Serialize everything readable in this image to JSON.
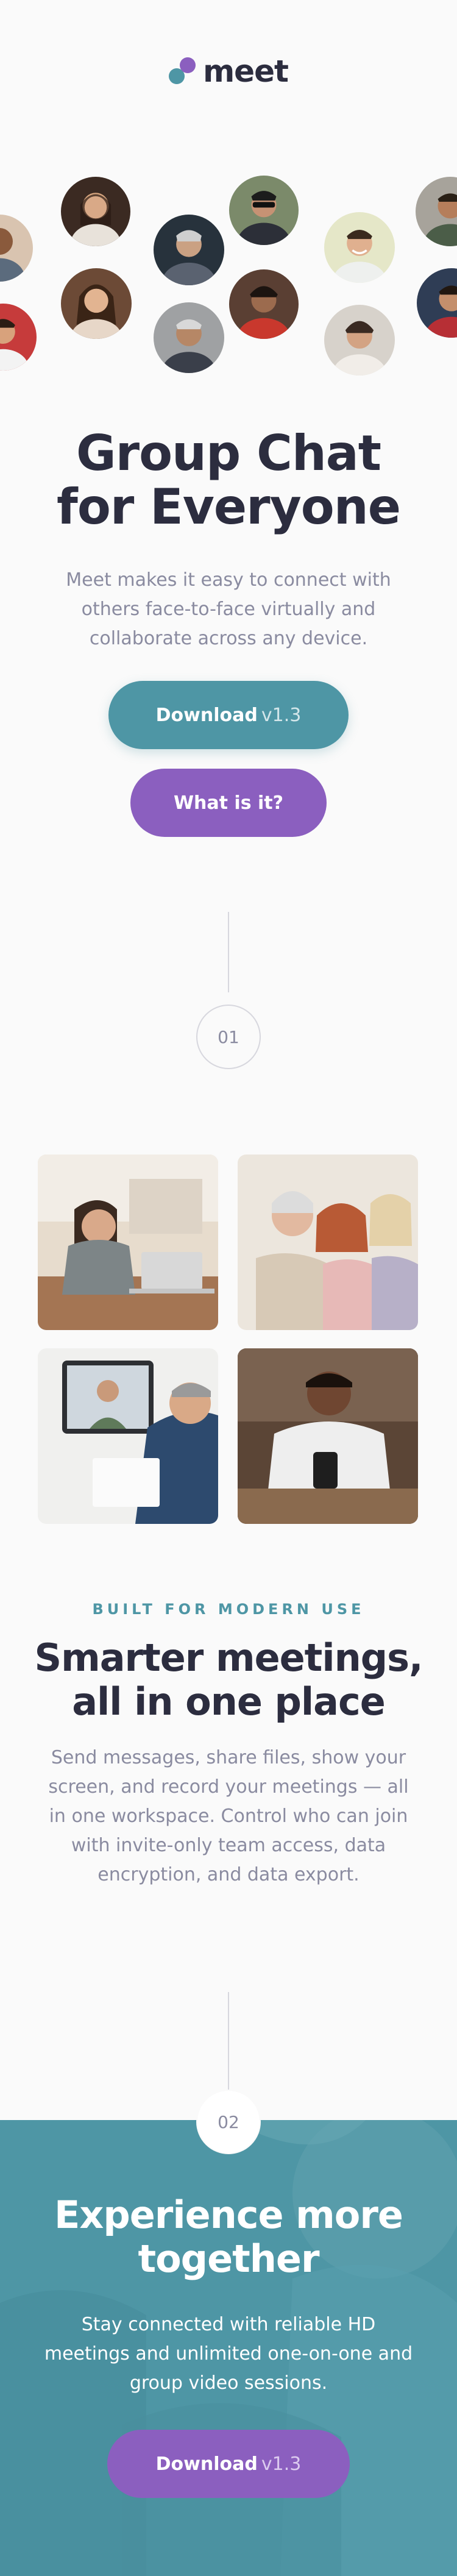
{
  "header": {
    "logo_text": "meet"
  },
  "hero": {
    "title_line1": "Group Chat",
    "title_line2": "for Everyone",
    "description": "Meet makes it easy to connect with others face-to-face virtually and collaborate across any device.",
    "download_label": "Download",
    "download_version": "v1.3",
    "what_label": "What is it?"
  },
  "steps": {
    "step1": "01",
    "step2": "02"
  },
  "features": {
    "eyebrow": "BUILT FOR MODERN USE",
    "title_line1": "Smarter meetings,",
    "title_line2": "all in one place",
    "description": "Send messages, share files, show your screen, and record your meetings — all in one workspace. Control who can join with invite-only team access, data encryption, and data export."
  },
  "cta": {
    "title_line1": "Experience more",
    "title_line2": "together",
    "description": "Stay connected with reliable HD meetings and unlimited one-on-one and group video sessions.",
    "download_label": "Download",
    "download_version": "v1.3"
  },
  "colors": {
    "teal": "#4e96a5",
    "purple": "#8b5fbf",
    "dark": "#2c2d3f",
    "muted": "#8a8ba0"
  }
}
